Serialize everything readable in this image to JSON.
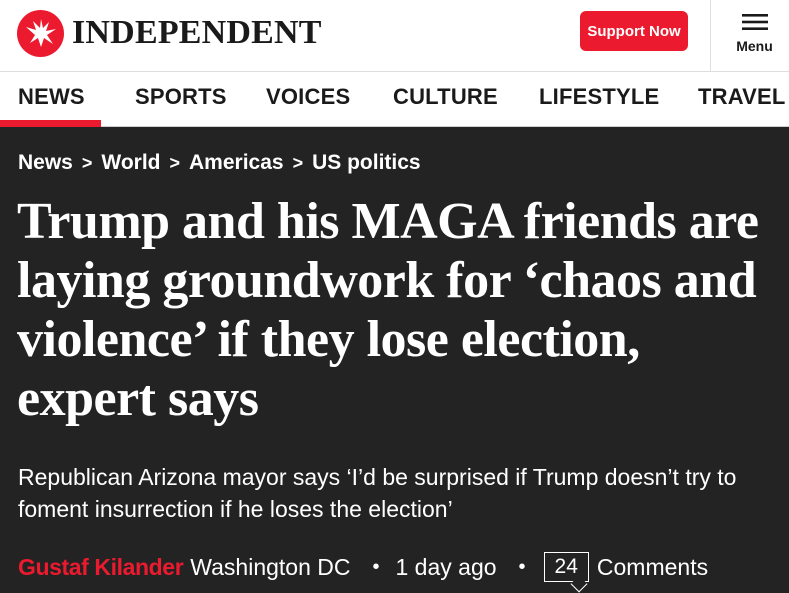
{
  "header": {
    "logo_text": "INDEPENDENT",
    "support_label": "Support Now",
    "menu_label": "Menu"
  },
  "nav": {
    "items": [
      {
        "label": "NEWS",
        "active": true
      },
      {
        "label": "SPORTS"
      },
      {
        "label": "VOICES"
      },
      {
        "label": "CULTURE"
      },
      {
        "label": "LIFESTYLE"
      },
      {
        "label": "TRAVEL"
      }
    ]
  },
  "breadcrumb": {
    "items": [
      "News",
      "World",
      "Americas",
      "US politics"
    ],
    "separator": ">"
  },
  "article": {
    "headline": "Trump and his MAGA friends are laying groundwork for ‘chaos and violence’ if they lose election, expert says",
    "standfirst": "Republican Arizona mayor says ‘I’d be surprised if Trump doesn’t try to foment insurrection if he loses the election’",
    "author": "Gustaf Kilander",
    "location": "Washington DC",
    "time": "1 day ago",
    "comment_count": "24",
    "comments_label": "Comments"
  },
  "colors": {
    "brand_red": "#ec1a2e",
    "article_background": "#232323",
    "header_background": "#ffffff"
  },
  "icons": {
    "logo": "eagle-logo-icon",
    "menu": "hamburger-menu-icon",
    "comments": "comment-bubble-icon"
  }
}
